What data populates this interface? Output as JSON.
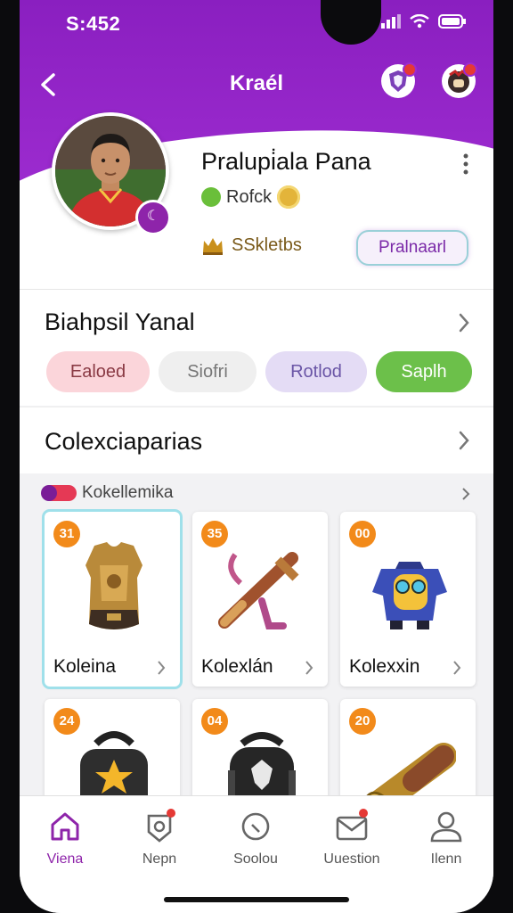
{
  "status_bar": {
    "time": "S:452"
  },
  "header": {
    "title": "Kraél"
  },
  "profile": {
    "name": "Pralupi̇ala Pana",
    "rank_label": "Rofck",
    "skill_label": "SSkletbs",
    "primary_button": "Pralnaarl"
  },
  "section1": {
    "title": "Biahpsil Yanal",
    "pills": [
      {
        "label": "Ealoed",
        "bg": "#fbd5da",
        "fg": "#8a3a44"
      },
      {
        "label": "Siofri",
        "bg": "#efefef",
        "fg": "#777777"
      },
      {
        "label": "Rotlod",
        "bg": "#e4dcf5",
        "fg": "#6a55a6"
      },
      {
        "label": "Saplh",
        "bg": "#6cc04a",
        "fg": "#ffffff"
      }
    ]
  },
  "section2": {
    "title": "Colexciaparias",
    "sub_header": "Kokellemika",
    "tiles": [
      {
        "num": "31",
        "label": "Koleina",
        "icon": "armor-vest-icon"
      },
      {
        "num": "35",
        "label": "Kolexlán",
        "icon": "crossbow-icon"
      },
      {
        "num": "00",
        "label": "Kolexxin",
        "icon": "robot-costume-icon"
      },
      {
        "num": "24",
        "label": "",
        "icon": "star-backpack-icon"
      },
      {
        "num": "04",
        "label": "",
        "icon": "emblem-backpack-icon"
      },
      {
        "num": "20",
        "label": "",
        "icon": "spyglass-icon"
      }
    ]
  },
  "nav": {
    "items": [
      {
        "label": "Viena",
        "icon": "home-icon"
      },
      {
        "label": "Nepn",
        "icon": "badge-icon"
      },
      {
        "label": "Soolou",
        "icon": "search-icon"
      },
      {
        "label": "Uuestion",
        "icon": "mail-icon"
      },
      {
        "label": "Ilenn",
        "icon": "profile-icon"
      }
    ]
  },
  "colors": {
    "brand": "#9c2bcf",
    "accent": "#f28a1a",
    "success": "#6cc04a"
  }
}
